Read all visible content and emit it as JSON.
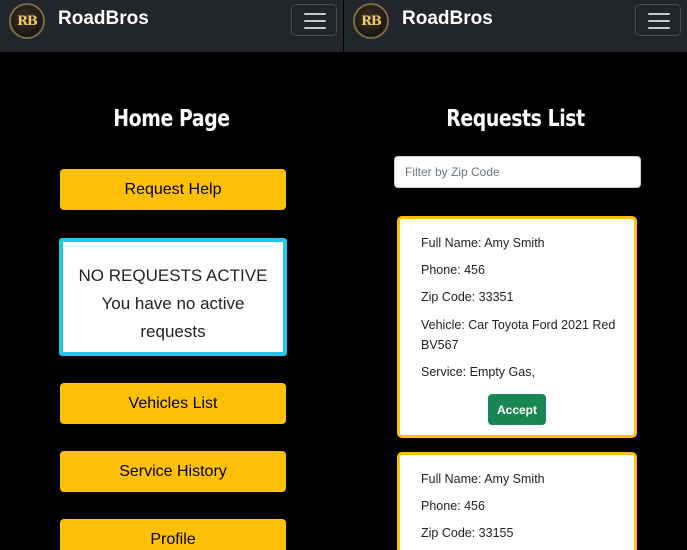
{
  "app": {
    "brand": "RoadBros",
    "logo_text": "RB"
  },
  "home": {
    "title": "Home Page",
    "buttons": {
      "request_help": "Request Help",
      "vehicles_list": "Vehicles List",
      "service_history": "Service History",
      "profile": "Profile"
    },
    "status": {
      "headline": "NO REQUESTS ACTIVE",
      "message": "You have no active requests"
    }
  },
  "requests": {
    "title": "Requests List",
    "filter_placeholder": "Filter by Zip Code",
    "items": [
      {
        "full_name": "Full Name: Amy Smith",
        "phone": "Phone: 456",
        "zip": "Zip Code: 33351",
        "vehicle": "Vehicle: Car Toyota Ford 2021 Red BV567",
        "service": "Service: Empty Gas,",
        "accept_label": "Accept"
      },
      {
        "full_name": "Full Name: Amy Smith",
        "phone": "Phone: 456",
        "zip": "Zip Code: 33155"
      }
    ]
  },
  "colors": {
    "navbar": "#222529",
    "accent_yellow": "#ffc107",
    "status_border": "#1ec8f0",
    "accept_green": "#198754"
  },
  "icons": {
    "menu": "hamburger-menu-icon"
  }
}
